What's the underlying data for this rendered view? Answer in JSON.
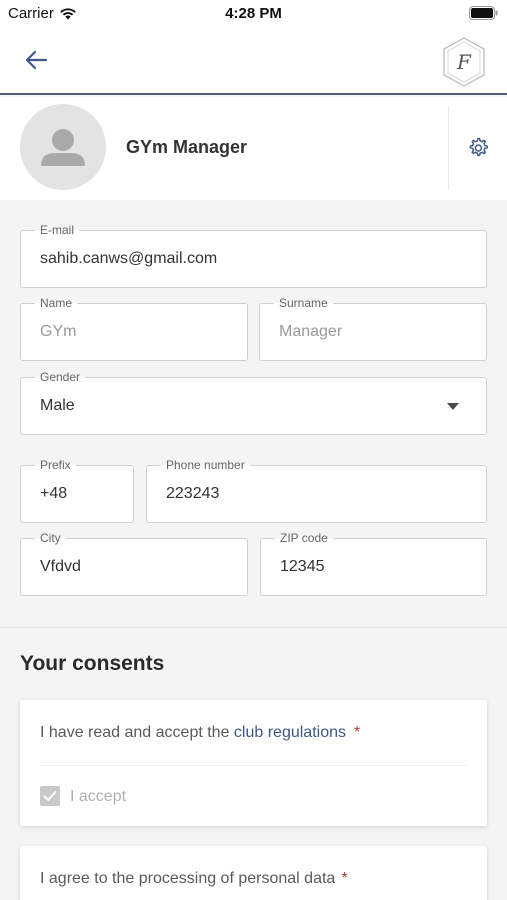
{
  "status_bar": {
    "carrier": "Carrier",
    "time": "4:28 PM"
  },
  "nav": {
    "back_icon": "arrow-left-icon",
    "logo_letter": "F"
  },
  "profile": {
    "name": "GYm Manager",
    "settings_icon": "gear-icon"
  },
  "form": {
    "email": {
      "label": "E-mail",
      "value": "sahib.canws@gmail.com"
    },
    "name": {
      "label": "Name",
      "value": "GYm"
    },
    "surname": {
      "label": "Surname",
      "value": "Manager"
    },
    "gender": {
      "label": "Gender",
      "value": "Male"
    },
    "prefix": {
      "label": "Prefix",
      "value": "+48"
    },
    "phone": {
      "label": "Phone number",
      "value": "223243"
    },
    "city": {
      "label": "City",
      "value": "Vfdvd"
    },
    "zip": {
      "label": "ZIP code",
      "value": "12345"
    }
  },
  "consents": {
    "title": "Your consents",
    "items": [
      {
        "text_before": "I have read and accept the ",
        "link": "club regulations",
        "required": "*",
        "accept_label": "I accept"
      },
      {
        "text_before": "I agree to the processing of personal data",
        "required": "*"
      }
    ]
  },
  "colors": {
    "accent": "#3a5a85",
    "required": "#c0392b",
    "nav_border": "#4f5f78"
  }
}
